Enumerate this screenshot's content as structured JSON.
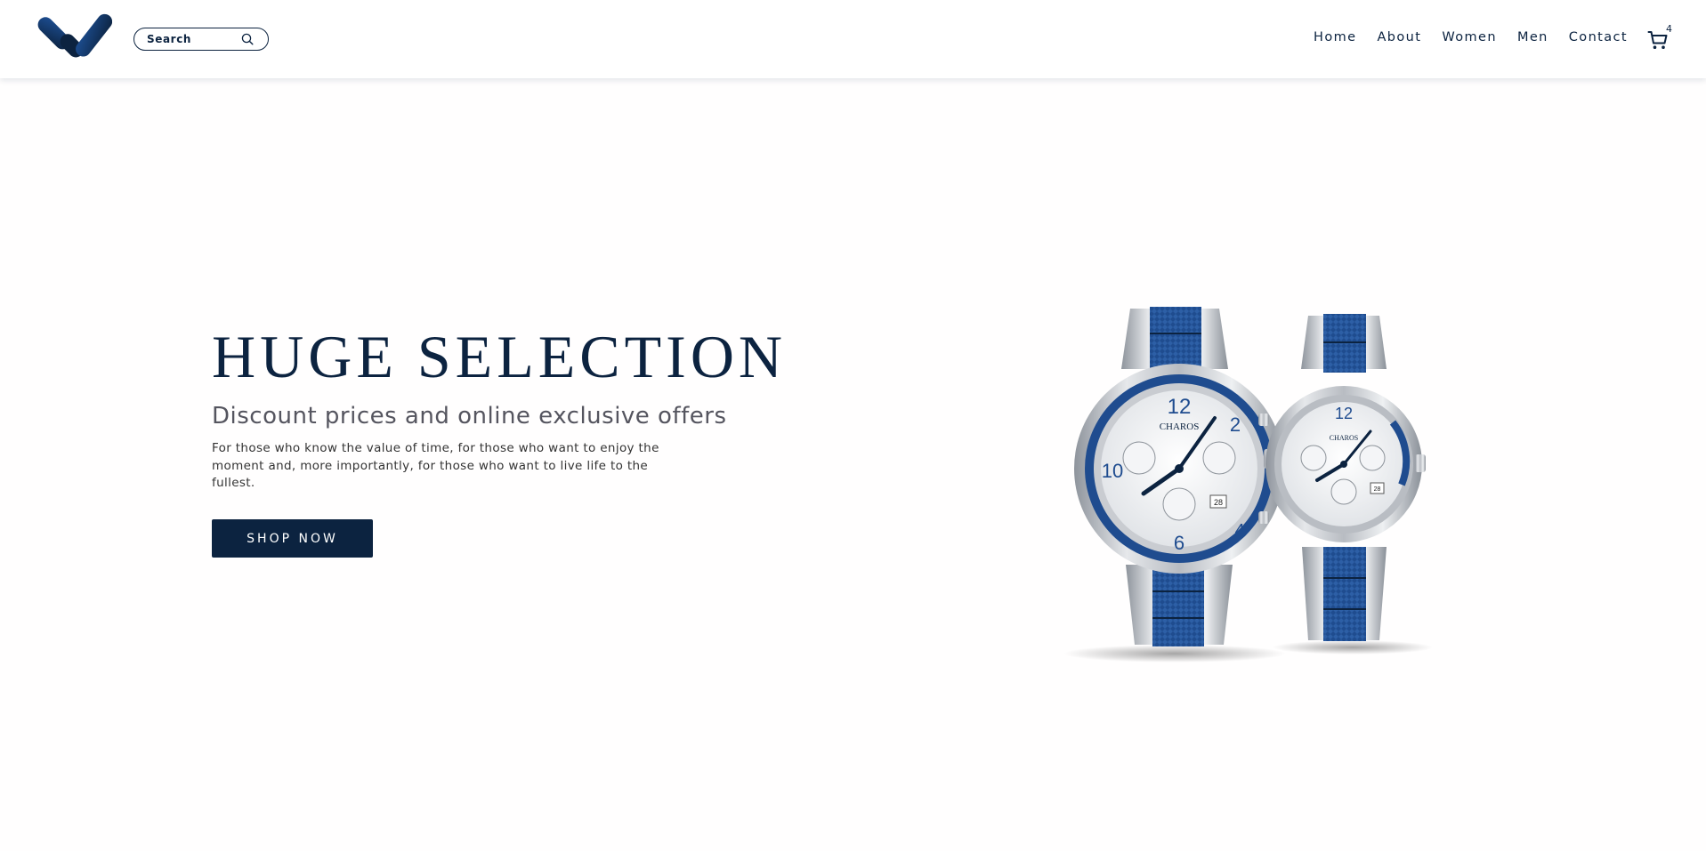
{
  "header": {
    "logo_alt": "W",
    "search": {
      "placeholder": "Search",
      "value": "",
      "icon": "search-icon"
    },
    "nav": [
      {
        "label": "Home"
      },
      {
        "label": "About"
      },
      {
        "label": "Women"
      },
      {
        "label": "Men"
      },
      {
        "label": "Contact"
      }
    ],
    "cart": {
      "icon": "cart-icon",
      "count": "4"
    }
  },
  "hero": {
    "title": "HUGE SELECTION",
    "subtitle": "Discount prices and online exclusive offers",
    "body": "For those who know the value of time, for those who want to enjoy the moment and, more importantly, for those who want to live life to the fullest.",
    "cta_label": "SHOP NOW"
  },
  "product_image": {
    "brand_text": "CHAROS",
    "date_large": "28",
    "date_small": "28"
  },
  "colors": {
    "brand": "#0c2340",
    "accent_blue": "#1f4c8f",
    "background": "#fffefe",
    "steel": "#c3c7cd"
  }
}
